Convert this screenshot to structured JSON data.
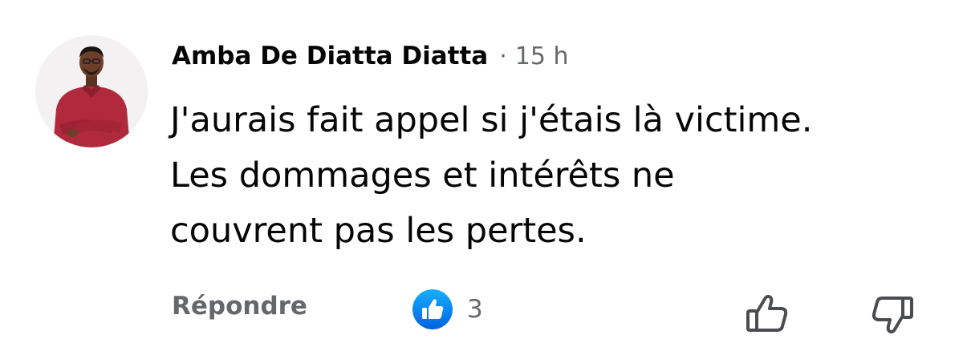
{
  "comment": {
    "author": "Amba De Diatta Diatta",
    "separator": "·",
    "time": "15 h",
    "text_lines": [
      "J'aurais fait appel si j'étais là victime.",
      "Les dommages et intérêts ne",
      "couvrent pas les pertes."
    ]
  },
  "actions": {
    "reply_label": "Répondre",
    "reaction_count": "3",
    "reaction_icon": "like-thumb-icon",
    "upvote_icon": "thumbs-up-outline-icon",
    "downvote_icon": "thumbs-down-outline-icon"
  },
  "colors": {
    "text_primary": "#050505",
    "text_secondary": "#65676b",
    "like_blue": "#1877f2",
    "shirt_red": "#b0293c"
  }
}
